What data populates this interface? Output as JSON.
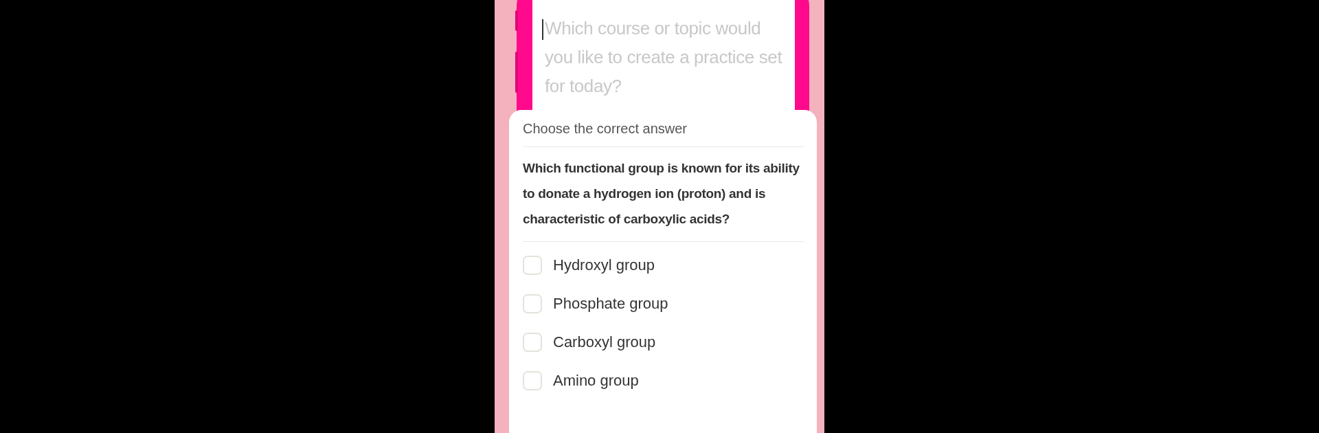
{
  "prompt_field": {
    "placeholder": "Which course or topic would you like to create a practice set for today?"
  },
  "quiz": {
    "instruction": "Choose the correct answer",
    "question": "Which functional group is known for its ability to donate a hydrogen ion (proton) and is characteristic of carboxylic acids?",
    "options": [
      {
        "label": "Hydroxyl group",
        "checked": false
      },
      {
        "label": "Phosphate group",
        "checked": false
      },
      {
        "label": "Carboxyl group",
        "checked": false
      },
      {
        "label": "Amino group",
        "checked": false
      }
    ]
  }
}
